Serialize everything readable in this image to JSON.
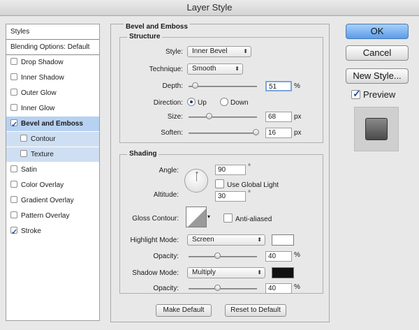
{
  "window": {
    "title": "Layer Style"
  },
  "sidebar": {
    "header": "Styles",
    "items": [
      {
        "label": "Blending Options: Default",
        "checkbox": false,
        "checked": false,
        "selected": false,
        "sub": false
      },
      {
        "label": "Drop Shadow",
        "checkbox": true,
        "checked": false,
        "selected": false,
        "sub": false
      },
      {
        "label": "Inner Shadow",
        "checkbox": true,
        "checked": false,
        "selected": false,
        "sub": false
      },
      {
        "label": "Outer Glow",
        "checkbox": true,
        "checked": false,
        "selected": false,
        "sub": false
      },
      {
        "label": "Inner Glow",
        "checkbox": true,
        "checked": false,
        "selected": false,
        "sub": false
      },
      {
        "label": "Bevel and Emboss",
        "checkbox": true,
        "checked": true,
        "selected": true,
        "sub": false
      },
      {
        "label": "Contour",
        "checkbox": true,
        "checked": false,
        "selected": false,
        "sub": true
      },
      {
        "label": "Texture",
        "checkbox": true,
        "checked": false,
        "selected": false,
        "sub": true
      },
      {
        "label": "Satin",
        "checkbox": true,
        "checked": false,
        "selected": false,
        "sub": false
      },
      {
        "label": "Color Overlay",
        "checkbox": true,
        "checked": false,
        "selected": false,
        "sub": false
      },
      {
        "label": "Gradient Overlay",
        "checkbox": true,
        "checked": false,
        "selected": false,
        "sub": false
      },
      {
        "label": "Pattern Overlay",
        "checkbox": true,
        "checked": false,
        "selected": false,
        "sub": false
      },
      {
        "label": "Stroke",
        "checkbox": true,
        "checked": true,
        "selected": false,
        "sub": false
      }
    ]
  },
  "panel": {
    "title": "Bevel and Emboss",
    "structure": {
      "title": "Structure",
      "style_label": "Style:",
      "style_value": "Inner Bevel",
      "technique_label": "Technique:",
      "technique_value": "Smooth",
      "depth_label": "Depth:",
      "depth_value": "51",
      "depth_unit": "%",
      "depth_fraction": 0.051,
      "direction_label": "Direction:",
      "dir_up": "Up",
      "dir_down": "Down",
      "size_label": "Size:",
      "size_value": "68",
      "size_unit": "px",
      "size_fraction": 0.27,
      "soften_label": "Soften:",
      "soften_value": "16",
      "soften_unit": "px",
      "soften_fraction": 1.0
    },
    "shading": {
      "title": "Shading",
      "angle_label": "Angle:",
      "angle_value": "90",
      "angle_unit": "°",
      "global_light_label": "Use Global Light",
      "altitude_label": "Altitude:",
      "altitude_value": "30",
      "altitude_unit": "°",
      "gloss_label": "Gloss Contour:",
      "anti_aliased_label": "Anti-aliased",
      "highlight_label": "Highlight Mode:",
      "highlight_value": "Screen",
      "highlight_color": "#ffffff",
      "hl_opacity_label": "Opacity:",
      "hl_opacity_value": "40",
      "hl_opacity_unit": "%",
      "hl_opacity_fraction": 0.4,
      "shadow_label": "Shadow Mode:",
      "shadow_value": "Multiply",
      "shadow_color": "#111111",
      "sh_opacity_label": "Opacity:",
      "sh_opacity_value": "40",
      "sh_opacity_unit": "%",
      "sh_opacity_fraction": 0.4
    },
    "make_default": "Make Default",
    "reset_default": "Reset to Default"
  },
  "buttons": {
    "ok": "OK",
    "cancel": "Cancel",
    "new_style": "New Style...",
    "preview": "Preview"
  }
}
